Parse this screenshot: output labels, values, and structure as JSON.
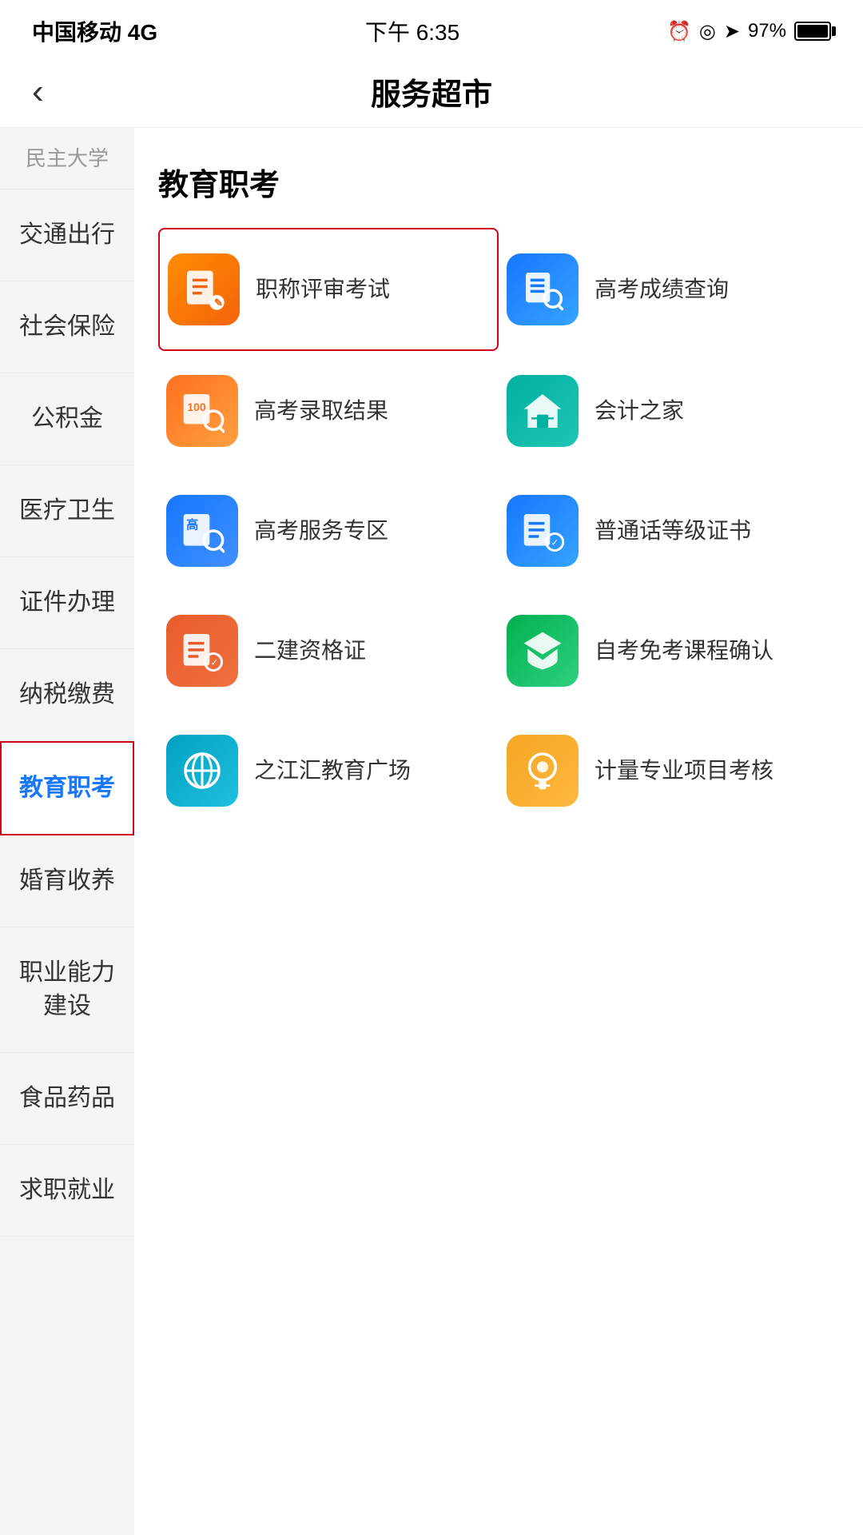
{
  "status_bar": {
    "carrier": "中国移动 4G",
    "time": "下午 6:35",
    "battery": "97%"
  },
  "nav": {
    "title": "服务超市",
    "back_label": "‹"
  },
  "sidebar": {
    "items": [
      {
        "id": "civil-aviation",
        "label": "民主大学",
        "active": false
      },
      {
        "id": "traffic",
        "label": "交通出行",
        "active": false
      },
      {
        "id": "social-insurance",
        "label": "社会保险",
        "active": false
      },
      {
        "id": "provident-fund",
        "label": "公积金",
        "active": false
      },
      {
        "id": "medical",
        "label": "医疗卫生",
        "active": false
      },
      {
        "id": "certificates",
        "label": "证件办理",
        "active": false
      },
      {
        "id": "tax",
        "label": "纳税缴费",
        "active": false
      },
      {
        "id": "education",
        "label": "教育职考",
        "active": true
      },
      {
        "id": "marriage",
        "label": "婚育收养",
        "active": false
      },
      {
        "id": "career",
        "label": "职业能力建设",
        "active": false
      },
      {
        "id": "food-drug",
        "label": "食品药品",
        "active": false
      },
      {
        "id": "employment",
        "label": "求职就业",
        "active": false
      }
    ]
  },
  "content": {
    "section_title": "教育职考",
    "services": [
      {
        "id": "title-exam",
        "name": "职称评审考试",
        "icon_type": "orange",
        "icon_key": "person-badge",
        "highlighted": true
      },
      {
        "id": "gaokao-score",
        "name": "高考成绩查询",
        "icon_type": "blue",
        "icon_key": "list-search",
        "highlighted": false
      },
      {
        "id": "gaokao-admission",
        "name": "高考录取结果",
        "icon_type": "orange2",
        "icon_key": "score-search",
        "highlighted": false
      },
      {
        "id": "accounting-home",
        "name": "会计之家",
        "icon_type": "teal",
        "icon_key": "house-list",
        "highlighted": false
      },
      {
        "id": "gaokao-service",
        "name": "高考服务专区",
        "icon_type": "blue2",
        "icon_key": "high-search",
        "highlighted": false
      },
      {
        "id": "putonghua-cert",
        "name": "普通话等级证书",
        "icon_type": "blue",
        "icon_key": "cert-list",
        "highlighted": false
      },
      {
        "id": "second-construction",
        "name": "二建资格证",
        "icon_type": "orange",
        "icon_key": "list-check",
        "highlighted": false
      },
      {
        "id": "self-study-confirm",
        "name": "自考免考课程确认",
        "icon_type": "green",
        "icon_key": "graduation-cap",
        "highlighted": false
      },
      {
        "id": "zhijianhui-edu",
        "name": "之江汇教育广场",
        "icon_type": "cyan",
        "icon_key": "edu-layers",
        "highlighted": false
      },
      {
        "id": "metrology-exam",
        "name": "计量专业项目考核",
        "icon_type": "amber",
        "icon_key": "badge-check",
        "highlighted": false
      }
    ]
  }
}
